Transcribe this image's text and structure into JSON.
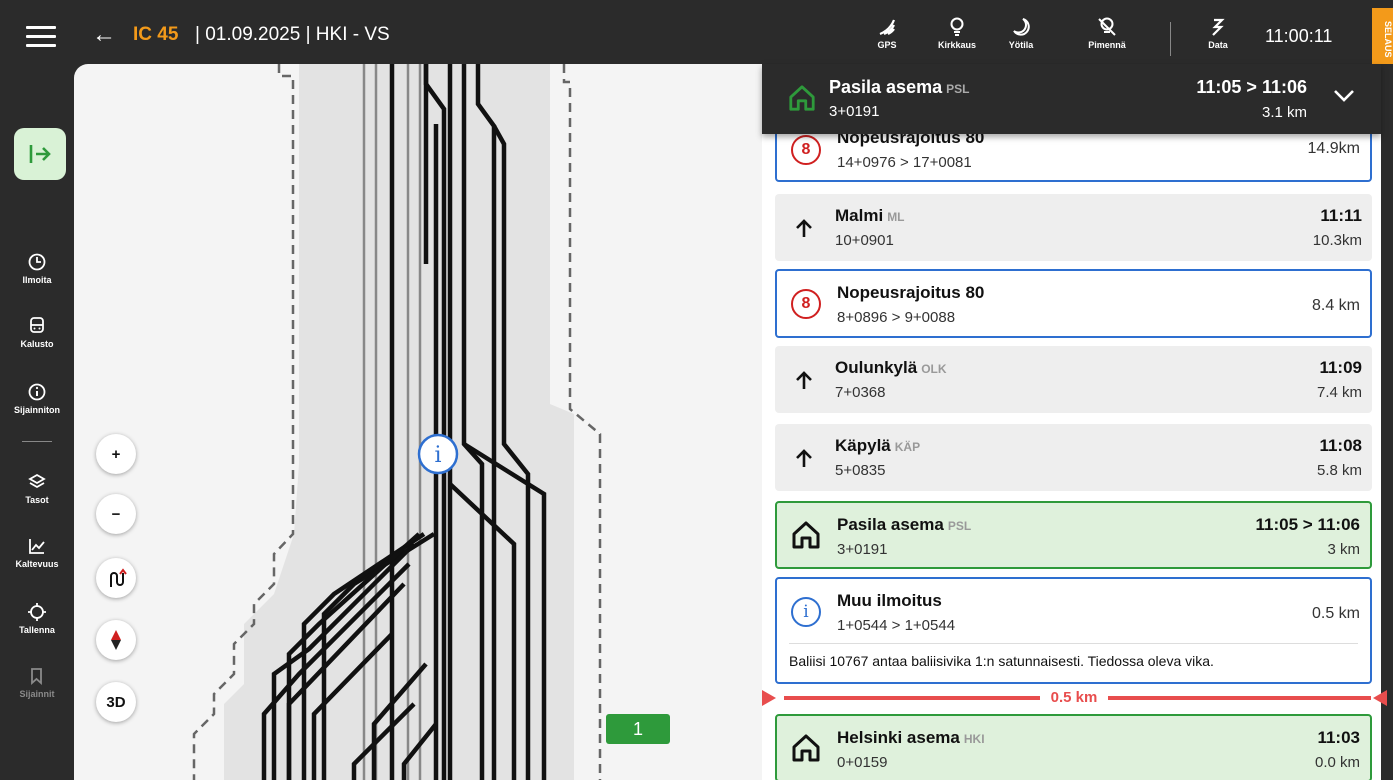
{
  "topbar": {
    "train": "IC 45",
    "trip": "| 01.09.2025 | HKI - VS",
    "buttons": [
      {
        "icon": "gps-icon",
        "label": "GPS"
      },
      {
        "icon": "lightbulb-icon",
        "label": "Kirkkaus"
      },
      {
        "icon": "moon-icon",
        "label": "Yötila"
      },
      {
        "icon": "dim-icon",
        "label": "Pimennä"
      },
      {
        "icon": "data-icon",
        "label": "Data"
      }
    ],
    "clock": "11:00:11",
    "mode_badge": "SELAUS"
  },
  "sidebar": {
    "items": [
      {
        "icon": "history-icon",
        "label": "Ilmoita"
      },
      {
        "icon": "train-icon",
        "label": "Kalusto"
      },
      {
        "icon": "info-icon",
        "label": "Sijainniton"
      },
      {
        "icon": "layers-icon",
        "label": "Tasot"
      },
      {
        "icon": "chart-icon",
        "label": "Kaltevuus"
      },
      {
        "icon": "crosshair-icon",
        "label": "Tallenna"
      },
      {
        "icon": "bookmark-icon",
        "label": "Sijainnit"
      }
    ]
  },
  "map": {
    "controls": {
      "zoom_in": "+",
      "zoom_out": "−",
      "mode_3d": "3D"
    },
    "track_badge": "1"
  },
  "next_station": {
    "name": "Pasila asema",
    "code": "PSL",
    "km": "3+0191",
    "time": "11:05 > 11:06",
    "distance": "3.1 km"
  },
  "events": [
    {
      "type": "limit",
      "limit": "8",
      "title": "Nopeusrajoitus 80",
      "km": "14+0976 > 17+0081",
      "distance": "14.9km"
    },
    {
      "type": "stop",
      "title": "Malmi",
      "code": "ML",
      "km": "10+0901",
      "time": "11:11",
      "distance": "10.3km"
    },
    {
      "type": "limit",
      "limit": "8",
      "title": "Nopeusrajoitus 80",
      "km": "8+0896 > 9+0088",
      "distance": "8.4 km"
    },
    {
      "type": "stop",
      "title": "Oulunkylä",
      "code": "OLK",
      "km": "7+0368",
      "time": "11:09",
      "distance": "7.4 km"
    },
    {
      "type": "stop",
      "title": "Käpylä",
      "code": "KÄP",
      "km": "5+0835",
      "time": "11:08",
      "distance": "5.8 km"
    },
    {
      "type": "station",
      "title": "Pasila asema",
      "code": "PSL",
      "km": "3+0191",
      "time": "11:05 > 11:06",
      "distance": "3 km"
    },
    {
      "type": "info",
      "title": "Muu ilmoitus",
      "km": "1+0544 > 1+0544",
      "distance": "0.5 km",
      "note": "Baliisi 10767 antaa baliisivika 1:n satunnaisesti. Tiedossa oleva vika."
    },
    {
      "type": "station",
      "title": "Helsinki asema",
      "code": "HKI",
      "km": "0+0159",
      "time": "11:03",
      "distance": "0.0 km"
    }
  ],
  "distance_marker": "0.5 km",
  "colors": {
    "accent": "#f39a1a",
    "station": "#2e9a3b",
    "info": "#2e6fd0",
    "limit": "#d02020",
    "marker": "#e84d4d"
  }
}
